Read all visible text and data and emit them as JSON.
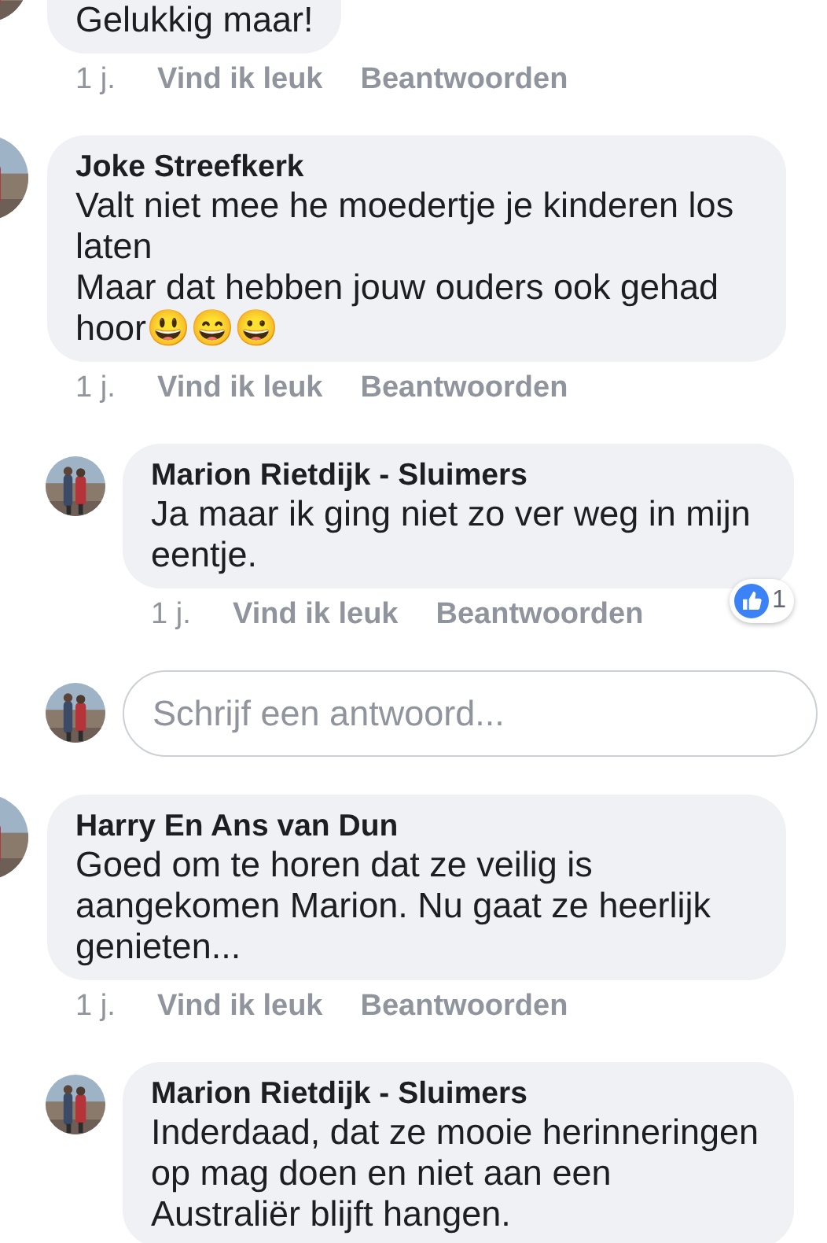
{
  "comments": [
    {
      "text": "Gelukkig maar!",
      "actions": {
        "time": "1 j.",
        "like": "Vind ik leuk",
        "reply": "Beantwoorden"
      }
    },
    {
      "author": "Joke Streefkerk",
      "text": "Valt niet mee he moedertje je kinderen los laten\nMaar dat hebben jouw ouders ook gehad hoor😃😄😀",
      "actions": {
        "time": "1 j.",
        "like": "Vind ik leuk",
        "reply": "Beantwoorden"
      },
      "children": [
        {
          "kind": "reply",
          "author": "Marion Rietdijk - Sluimers",
          "text": "Ja maar ik ging niet zo ver weg in mijn eentje.",
          "actions": {
            "time": "1 j.",
            "like": "Vind ik leuk",
            "reply": "Beantwoorden"
          },
          "reactions": "1"
        },
        {
          "kind": "reply_field",
          "placeholder": "Schrijf een antwoord..."
        }
      ]
    },
    {
      "author": "Harry En Ans van Dun",
      "text": "Goed om te horen dat ze veilig is aangekomen Marion. Nu gaat ze heerlijk genieten...",
      "actions": {
        "time": "1 j.",
        "like": "Vind ik leuk",
        "reply": "Beantwoorden"
      },
      "children": [
        {
          "kind": "reply",
          "author": "Marion Rietdijk - Sluimers",
          "text": "Inderdaad, dat ze mooie herinneringen op mag doen en niet aan een Australiër blijft hangen."
        }
      ]
    }
  ]
}
